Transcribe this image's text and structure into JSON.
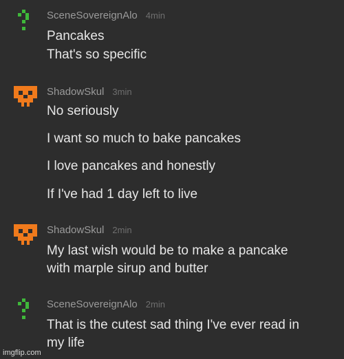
{
  "messages": [
    {
      "user": "SceneSovereignAlo",
      "time": "4min",
      "avatar": "green-question-mark-icon",
      "lines": [
        "Pancakes",
        "That's so specific"
      ]
    },
    {
      "user": "ShadowSkul",
      "time": "3min",
      "avatar": "orange-skull-icon",
      "lines": [
        "No seriously",
        "I want so much to bake pancakes",
        "I love pancakes and honestly",
        "If I've had 1 day left to live"
      ]
    },
    {
      "user": "ShadowSkul",
      "time": "2min",
      "avatar": "orange-skull-icon",
      "lines": [
        "My last wish would be to make a pancake",
        "with marple sirup and butter"
      ]
    },
    {
      "user": "SceneSovereignAlo",
      "time": "2min",
      "avatar": "green-question-mark-icon",
      "lines": [
        "That is the cutest sad thing I've ever read in",
        "my life"
      ]
    }
  ],
  "watermark": "imgflip.com",
  "colors": {
    "background": "#2d2d2d",
    "skull": "#f07a1c",
    "question": "#3fb83a"
  }
}
